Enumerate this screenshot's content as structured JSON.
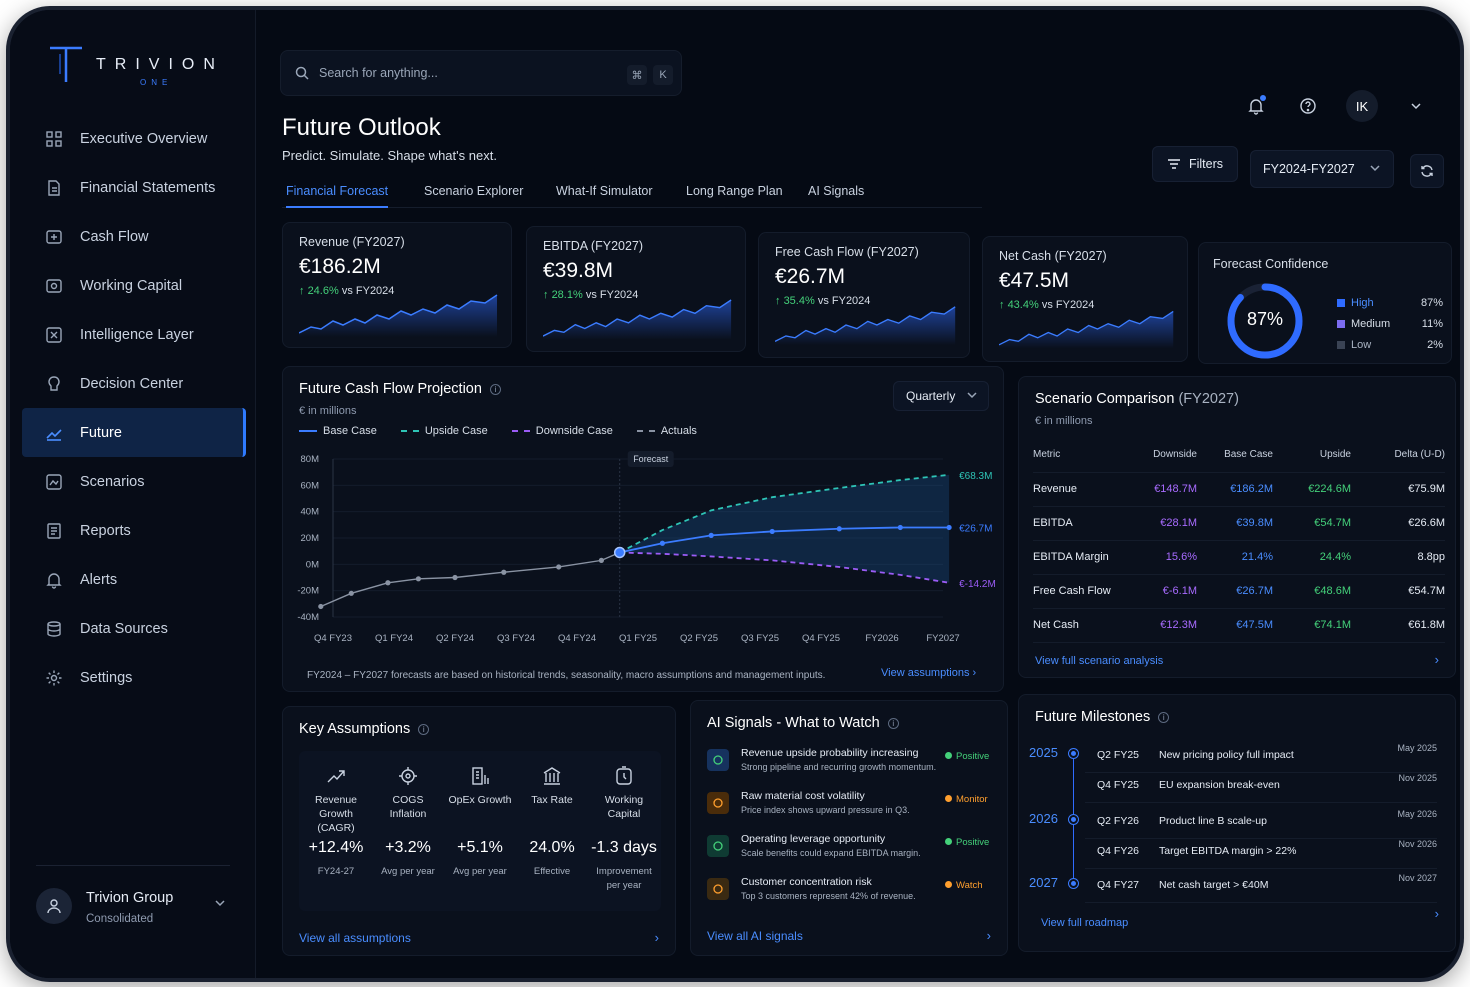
{
  "brand": {
    "name": "TRIVION",
    "sub": "ONE"
  },
  "sidebar": {
    "items": [
      {
        "label": "Executive Overview",
        "icon": "grid-icon"
      },
      {
        "label": "Financial Statements",
        "icon": "document-icon"
      },
      {
        "label": "Cash Flow",
        "icon": "cash-flow-icon"
      },
      {
        "label": "Working Capital",
        "icon": "wallet-icon"
      },
      {
        "label": "Intelligence Layer",
        "icon": "spark-icon"
      },
      {
        "label": "Decision Center",
        "icon": "brain-icon"
      },
      {
        "label": "Future",
        "icon": "trend-icon",
        "active": true
      },
      {
        "label": "Scenarios",
        "icon": "scenarios-icon"
      },
      {
        "label": "Reports",
        "icon": "report-icon"
      },
      {
        "label": "Alerts",
        "icon": "bell-icon"
      },
      {
        "label": "Data Sources",
        "icon": "database-icon"
      },
      {
        "label": "Settings",
        "icon": "gear-icon"
      }
    ],
    "org": {
      "name": "Trivion Group",
      "sub": "Consolidated"
    }
  },
  "search": {
    "placeholder": "Search for anything...",
    "kbd1": "⌘",
    "kbd2": "K"
  },
  "header": {
    "avatar": "IK",
    "title": "Future Outlook",
    "subtitle": "Predict. Simulate. Shape what's next.",
    "filters": "Filters",
    "range": "FY2024-FY2027"
  },
  "tabs": [
    "Financial Forecast",
    "Scenario Explorer",
    "What-If Simulator",
    "Long Range Plan",
    "AI Signals"
  ],
  "kpis": [
    {
      "label": "Revenue (FY2027)",
      "value": "€186.2M",
      "delta": "24.6%",
      "vs": "vs FY2024"
    },
    {
      "label": "EBITDA (FY2027)",
      "value": "€39.8M",
      "delta": "28.1%",
      "vs": "vs FY2024"
    },
    {
      "label": "Free Cash Flow (FY2027)",
      "value": "€26.7M",
      "delta": "35.4%",
      "vs": "vs FY2024"
    },
    {
      "label": "Net Cash (FY2027)",
      "value": "€47.5M",
      "delta": "43.4%",
      "vs": "vs FY2024"
    }
  ],
  "confidence": {
    "label": "Forecast Confidence",
    "value": "87%",
    "value_fraction": 0.87,
    "legend": [
      {
        "name": "High",
        "pct": "87%",
        "color": "#2f6bff"
      },
      {
        "name": "Medium",
        "pct": "11%",
        "color": "#7c6cf0"
      },
      {
        "name": "Low",
        "pct": "2%",
        "color": "#3a4354"
      }
    ]
  },
  "projection": {
    "title": "Future Cash Flow Projection",
    "unit": "€ in millions",
    "period": "Quarterly",
    "forecast_label": "Forecast",
    "footnote": "FY2024 – FY2027 forecasts are based on historical trends, seasonality, macro assumptions and management inputs.",
    "link": "View assumptions"
  },
  "chart_data": {
    "type": "line",
    "title": "Future Cash Flow Projection",
    "ylabel": "€ in millions",
    "categories": [
      "Q4 FY23",
      "Q1 FY24",
      "Q2 FY24",
      "Q3 FY24",
      "Q4 FY24",
      "Q1 FY25",
      "Q2 FY25",
      "Q3 FY25",
      "Q4 FY25",
      "FY2026",
      "FY2027"
    ],
    "y_ticks": [
      "80M",
      "60M",
      "40M",
      "20M",
      "0M",
      "-20M",
      "-40M"
    ],
    "ylim": [
      -40,
      80
    ],
    "series": [
      {
        "name": "Actuals",
        "color": "#8a93a3",
        "x": [
          -0.2,
          0.3,
          0.9,
          1.4,
          2.0,
          2.8,
          3.7,
          4.4,
          4.7
        ],
        "values": [
          -32,
          -22,
          -14,
          -11,
          -10,
          -6,
          -2,
          3,
          9
        ]
      },
      {
        "name": "Base Case",
        "color": "#3b7cff",
        "x": [
          4.7,
          5.4,
          6.2,
          7.2,
          8.3,
          9.3,
          10.1
        ],
        "values": [
          9,
          16,
          22,
          25,
          27,
          28,
          28
        ]
      },
      {
        "name": "Upside Case",
        "color": "#2ec4b6",
        "x": [
          4.7,
          5.4,
          6.2,
          7.2,
          8.3,
          9.3,
          10.1
        ],
        "values": [
          9,
          26,
          41,
          51,
          58,
          64,
          68
        ]
      },
      {
        "name": "Downside Case",
        "color": "#9b5cf6",
        "x": [
          4.7,
          5.4,
          6.2,
          7.2,
          8.3,
          9.3,
          10.1
        ],
        "values": [
          9,
          8,
          6,
          3,
          -2,
          -8,
          -14
        ]
      }
    ],
    "end_labels": [
      {
        "text": "€68.3M",
        "value": 68,
        "color": "#2ec4b6"
      },
      {
        "text": "€26.7M",
        "value": 28,
        "color": "#3b7cff"
      },
      {
        "text": "€-14.2M",
        "value": -14,
        "color": "#9b5cf6"
      }
    ],
    "forecast_start_x": 4.7,
    "grid": true,
    "legend": "top-left"
  },
  "scenario": {
    "title": "Scenario Comparison",
    "title_suffix": "(FY2027)",
    "unit": "€ in millions",
    "headers": [
      "Metric",
      "Downside",
      "Base Case",
      "Upside",
      "Delta (U-D)"
    ],
    "rows": [
      [
        "Revenue",
        "€148.7M",
        "€186.2M",
        "€224.6M",
        "€75.9M"
      ],
      [
        "EBITDA",
        "€28.1M",
        "€39.8M",
        "€54.7M",
        "€26.6M"
      ],
      [
        "EBITDA Margin",
        "15.6%",
        "21.4%",
        "24.4%",
        "8.8pp"
      ],
      [
        "Free Cash Flow",
        "€-6.1M",
        "€26.7M",
        "€48.6M",
        "€54.7M"
      ],
      [
        "Net Cash",
        "€12.3M",
        "€47.5M",
        "€74.1M",
        "€61.8M"
      ]
    ],
    "link": "View full scenario analysis"
  },
  "assumptions": {
    "title": "Key Assumptions",
    "items": [
      {
        "name": "Revenue Growth (CAGR)",
        "value": "+12.4%",
        "sub": "FY24-27",
        "icon": "trend-up-icon"
      },
      {
        "name": "COGS Inflation",
        "value": "+3.2%",
        "sub": "Avg per year",
        "icon": "cogs-icon"
      },
      {
        "name": "OpEx Growth",
        "value": "+5.1%",
        "sub": "Avg per year",
        "icon": "building-chart-icon"
      },
      {
        "name": "Tax Rate",
        "value": "24.0%",
        "sub": "Effective",
        "icon": "bank-icon"
      },
      {
        "name": "Working Capital",
        "value": "-1.3 days",
        "sub": "Improvement per year",
        "icon": "clock-box-icon"
      }
    ],
    "link": "View all assumptions"
  },
  "signals": {
    "title": "AI Signals - What to Watch",
    "items": [
      {
        "title": "Revenue upside probability increasing",
        "desc": "Strong pipeline and recurring growth momentum.",
        "badge": "Positive",
        "color": "#44d17a",
        "bg": "#16325e",
        "icon": "chart-up-icon"
      },
      {
        "title": "Raw material cost volatility",
        "desc": "Price index shows upward pressure in Q3.",
        "badge": "Monitor",
        "color": "#ff9f2e",
        "bg": "#4a2c0a",
        "icon": "alert-circle-icon"
      },
      {
        "title": "Operating leverage opportunity",
        "desc": "Scale benefits could expand EBITDA margin.",
        "badge": "Positive",
        "color": "#44d17a",
        "bg": "#0f3b33",
        "icon": "bar-up-icon"
      },
      {
        "title": "Customer concentration risk",
        "desc": "Top 3 customers represent 42% of revenue.",
        "badge": "Watch",
        "color": "#ff9f2e",
        "bg": "#3a2a12",
        "icon": "target-icon"
      }
    ],
    "link": "View all AI signals"
  },
  "milestones": {
    "title": "Future Milestones",
    "items": [
      {
        "year": "2025",
        "q": "Q2 FY25",
        "desc": "New pricing policy full impact",
        "date": "May 2025"
      },
      {
        "year": "",
        "q": "Q4 FY25",
        "desc": "EU expansion break-even",
        "date": "Nov 2025"
      },
      {
        "year": "2026",
        "q": "Q2 FY26",
        "desc": "Product line B scale-up",
        "date": "May 2026"
      },
      {
        "year": "",
        "q": "Q4 FY26",
        "desc": "Target EBITDA margin > 22%",
        "date": "Nov 2026"
      },
      {
        "year": "2027",
        "q": "Q4 FY27",
        "desc": "Net cash target > €40M",
        "date": "Nov 2027"
      }
    ],
    "link": "View full roadmap"
  }
}
